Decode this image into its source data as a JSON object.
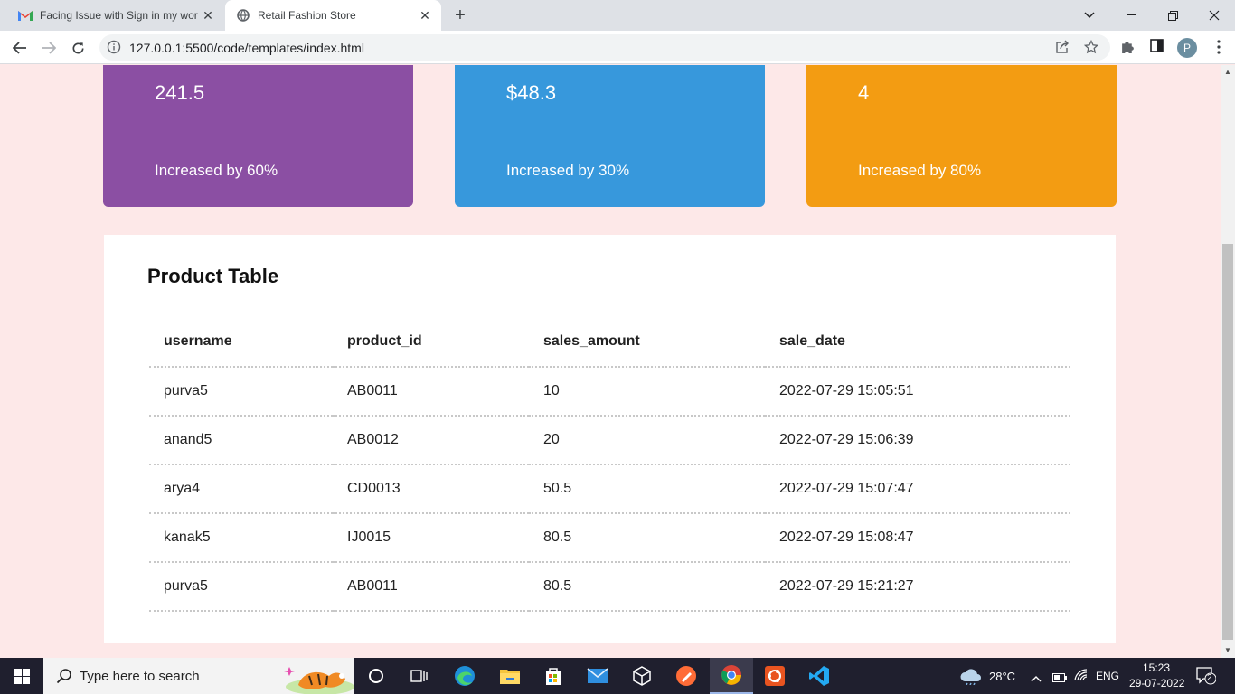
{
  "browser": {
    "tabs": [
      {
        "title": "Facing Issue with Sign in my worl",
        "icon": "gmail-icon",
        "active": false
      },
      {
        "title": "Retail Fashion Store",
        "icon": "globe-icon",
        "active": true
      }
    ],
    "url": "127.0.0.1:5500/code/templates/index.html",
    "profile_initial": "P"
  },
  "cards": [
    {
      "value": "241.5",
      "trend": "Increased by 60%",
      "color": "#8b4fa3"
    },
    {
      "value": "$48.3",
      "trend": "Increased by 30%",
      "color": "#3798dc"
    },
    {
      "value": "4",
      "trend": "Increased by 80%",
      "color": "#f39c12"
    }
  ],
  "table": {
    "title": "Product Table",
    "headers": [
      "username",
      "product_id",
      "sales_amount",
      "sale_date"
    ],
    "rows": [
      [
        "purva5",
        "AB0011",
        "10",
        "2022-07-29 15:05:51"
      ],
      [
        "anand5",
        "AB0012",
        "20",
        "2022-07-29 15:06:39"
      ],
      [
        "arya4",
        "CD0013",
        "50.5",
        "2022-07-29 15:07:47"
      ],
      [
        "kanak5",
        "IJ0015",
        "80.5",
        "2022-07-29 15:08:47"
      ],
      [
        "purva5",
        "AB0011",
        "80.5",
        "2022-07-29 15:21:27"
      ]
    ]
  },
  "taskbar": {
    "search_placeholder": "Type here to search",
    "weather": "28°C",
    "language": "ENG",
    "time": "15:23",
    "date": "29-07-2022",
    "notification_count": "2"
  }
}
